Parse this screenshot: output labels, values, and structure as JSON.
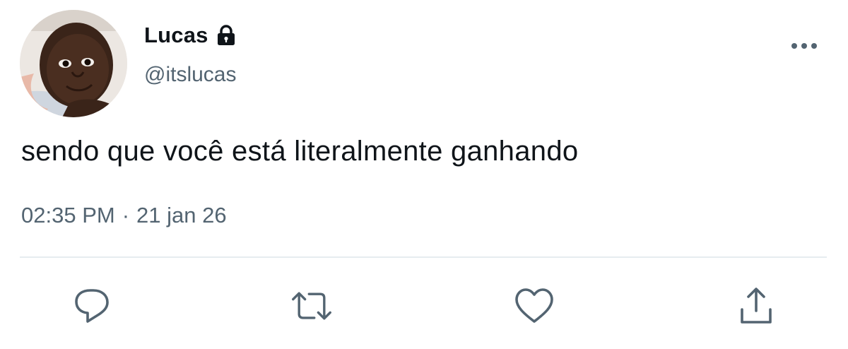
{
  "user": {
    "display_name": "Lucas",
    "handle": "@itslucas",
    "protected_icon": "lock-icon",
    "avatar": "profile-photo"
  },
  "tweet": {
    "text": "sendo que você está literalmente ganhando",
    "time": "02:35 PM",
    "separator": "·",
    "date": "21 jan 26"
  },
  "actions": [
    {
      "icon": "reply-icon"
    },
    {
      "icon": "retweet-icon"
    },
    {
      "icon": "like-icon"
    },
    {
      "icon": "share-icon"
    }
  ],
  "menu": {
    "icon": "more-options-icon"
  },
  "colors": {
    "text_primary": "#0f1419",
    "text_secondary": "#536471",
    "divider": "#e6ecf0",
    "icon": "#536471"
  }
}
